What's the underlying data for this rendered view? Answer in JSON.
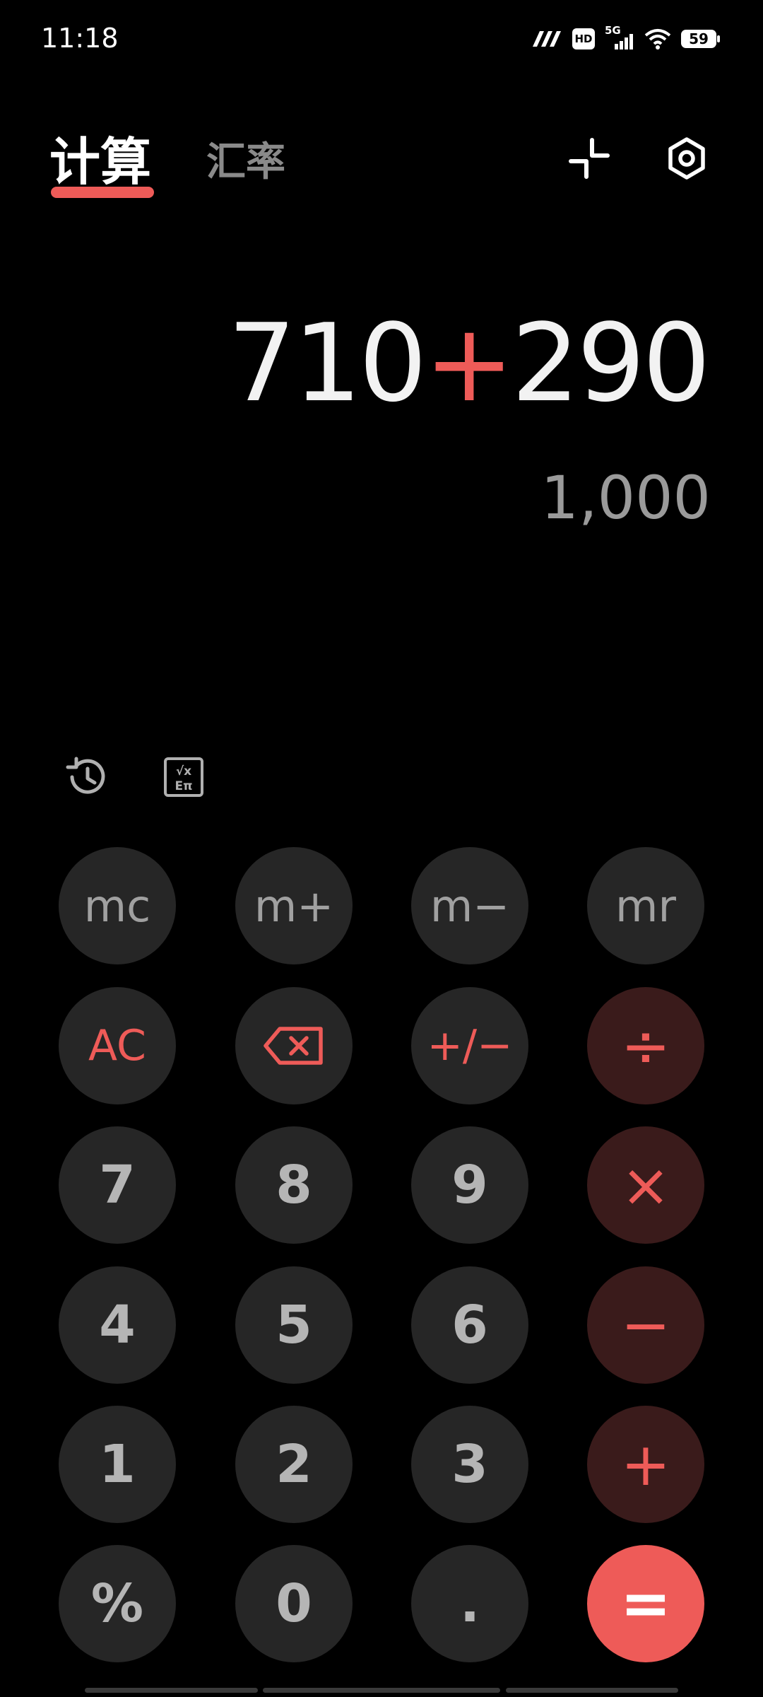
{
  "status_bar": {
    "time": "11:18",
    "network": "5G",
    "hd_label": "HD",
    "battery": "59"
  },
  "tabs": {
    "calculate": "计算",
    "exchange_rate": "汇率"
  },
  "display": {
    "operand1": "710",
    "operator": "+",
    "operand2": "290",
    "result": "1,000"
  },
  "keys": {
    "mc": "mc",
    "m_plus": "m+",
    "m_minus": "m−",
    "mr": "mr",
    "ac": "AC",
    "sign": "+/−",
    "divide": "÷",
    "multiply": "×",
    "minus": "−",
    "plus": "+",
    "equals": "=",
    "percent": "%",
    "dot": ".",
    "d0": "0",
    "d1": "1",
    "d2": "2",
    "d3": "3",
    "d4": "4",
    "d5": "5",
    "d6": "6",
    "d7": "7",
    "d8": "8",
    "d9": "9"
  },
  "icons": {
    "collapse": "collapse-icon",
    "settings": "settings-icon",
    "history": "history-icon",
    "scientific": "scientific-icon",
    "backspace": "backspace-icon"
  },
  "colors": {
    "accent": "#ee5b58",
    "key_bg": "#262626",
    "operator_key_bg": "#3a1b1b"
  }
}
